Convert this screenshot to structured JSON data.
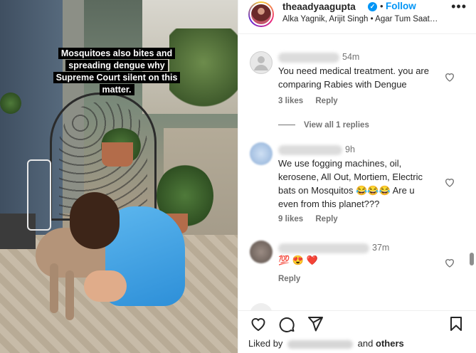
{
  "media": {
    "caption": "Mosquitoes also bites and spreading dengue why Supreme Court silent on this matter."
  },
  "header": {
    "username": "theaadyaagupta",
    "verified_badge": "✓",
    "dot": "•",
    "follow_label": "Follow",
    "more_icon": "more-horizontal-icon",
    "music": "Alka Yagnik, Arijit Singh • Agar Tum Saat…"
  },
  "comments": [
    {
      "time": "54m",
      "text": "You need medical treatment. you are comparing Rabies with Dengue",
      "likes": "3 likes",
      "reply": "Reply",
      "view_replies": "View all 1 replies",
      "avatar_color": "#dbdbdb"
    },
    {
      "time": "9h",
      "text": "We use fogging machines, oil, kerosene, All Out, Mortiem, Electric bats on Mosquitos 😂😂😂 Are u even from this planet???",
      "likes": "9 likes",
      "reply": "Reply",
      "avatar_color": "#a9c4e6"
    },
    {
      "time": "37m",
      "text": "💯 😍 ❤️",
      "reply": "Reply",
      "avatar_color": "#7a6d66"
    }
  ],
  "actions": {
    "icons": [
      "heart-icon",
      "comment-icon",
      "share-icon",
      "bookmark-icon"
    ],
    "liked_prefix": "Liked by",
    "liked_and": "and",
    "liked_others": "others"
  },
  "colors": {
    "accent": "#0095f6",
    "text": "#262626",
    "muted": "#737373",
    "caption_bg": "#000000"
  }
}
